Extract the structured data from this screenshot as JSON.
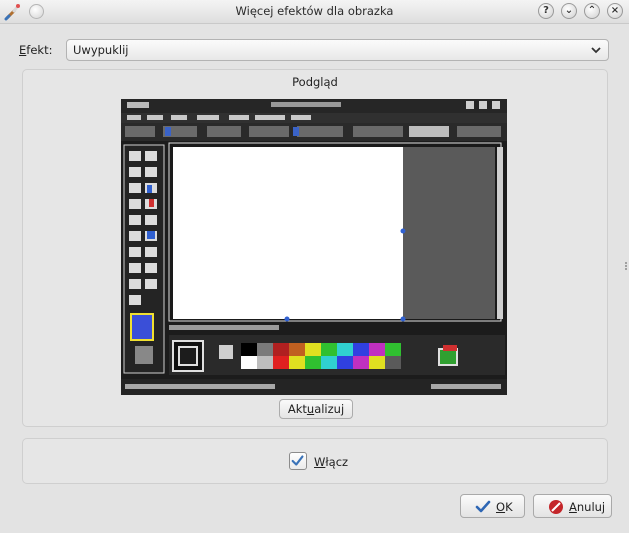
{
  "window": {
    "title": "Więcej efektów dla obrazka",
    "buttons": {
      "help": "?",
      "minimize": "⌄",
      "maximize": "⌃",
      "close": "×"
    }
  },
  "effect": {
    "label_prefix": "E",
    "label_rest": "fekt:",
    "value": "Uwypuklij"
  },
  "preview": {
    "title": "Podgląd",
    "update_prefix": "Akt",
    "update_accel": "u",
    "update_rest": "alizuj"
  },
  "enable": {
    "accel": "W",
    "rest": "łącz",
    "checked": true
  },
  "actions": {
    "ok_accel": "O",
    "ok_rest": "K",
    "cancel_accel": "A",
    "cancel_rest": "nuluj"
  },
  "colors": {
    "accent": "#3a73b8",
    "ok_check": "#2d66b4",
    "cancel_red": "#c4262a"
  },
  "icons": {
    "app": "paint-brush-icon",
    "ok": "checkmark-icon",
    "cancel": "cancel-icon"
  }
}
